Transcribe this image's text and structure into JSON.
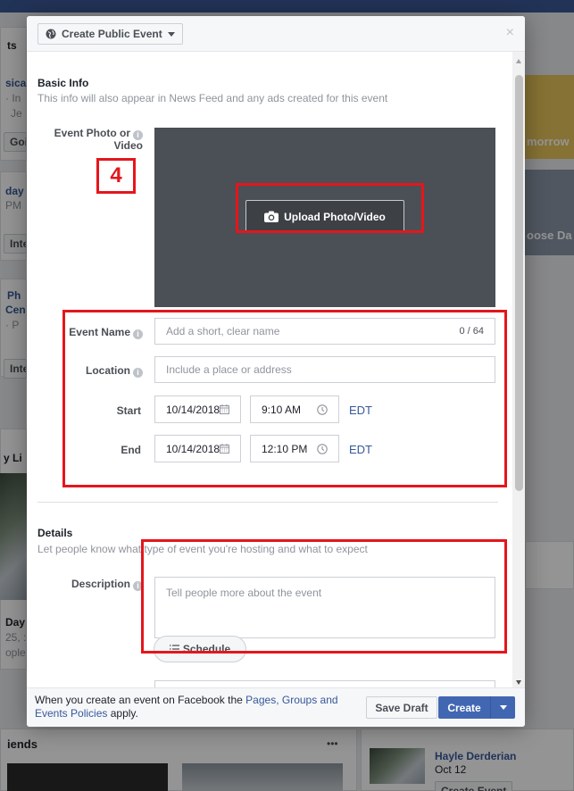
{
  "background": {
    "left_snippets": [
      "ts",
      "sica",
      "· In",
      "Je",
      "Goi",
      "day",
      "PM",
      "Inte",
      "Ph",
      "Cen",
      "· P",
      "Inte",
      "y Li",
      "Day",
      "25, :",
      "ople",
      "iends"
    ],
    "right_snippets": [
      "morrow",
      "oose Da"
    ],
    "friend_name": "Hayle Derderian",
    "friend_date": "Oct 12",
    "friend_button": "Create Event",
    "more_dots": "•••"
  },
  "dialog": {
    "type_button": "Create Public Event",
    "close_icon": "×",
    "basic_info": {
      "title": "Basic Info",
      "subtitle": "This info will also appear in News Feed and any ads created for this event"
    },
    "photo_label_line1": "Event Photo or",
    "photo_label_line2": "Video",
    "upload_button": "Upload Photo/Video",
    "event_name": {
      "label": "Event Name",
      "placeholder": "Add a short, clear name",
      "counter": "0 / 64"
    },
    "location": {
      "label": "Location",
      "placeholder": "Include a place or address"
    },
    "start": {
      "label": "Start",
      "date": "10/14/2018",
      "time": "9:10 AM",
      "tz": "EDT"
    },
    "end": {
      "label": "End",
      "date": "10/14/2018",
      "time": "12:10 PM",
      "tz": "EDT"
    },
    "details": {
      "title": "Details",
      "subtitle": "Let people know what type of event you're hosting and what to expect"
    },
    "description": {
      "label": "Description",
      "placeholder": "Tell people more about the event"
    },
    "schedule_button": "Schedule",
    "footer": {
      "note_prefix": "When you create an event on Facebook the",
      "policy_link": "Pages, Groups and Events Policies",
      "note_suffix": "apply.",
      "save_draft": "Save Draft",
      "create": "Create"
    }
  },
  "annotation": {
    "step_number": "4",
    "color": "#e4161c"
  },
  "colors": {
    "primary": "#4267b2",
    "link": "#365899",
    "header_bg": "#f6f7f9"
  }
}
